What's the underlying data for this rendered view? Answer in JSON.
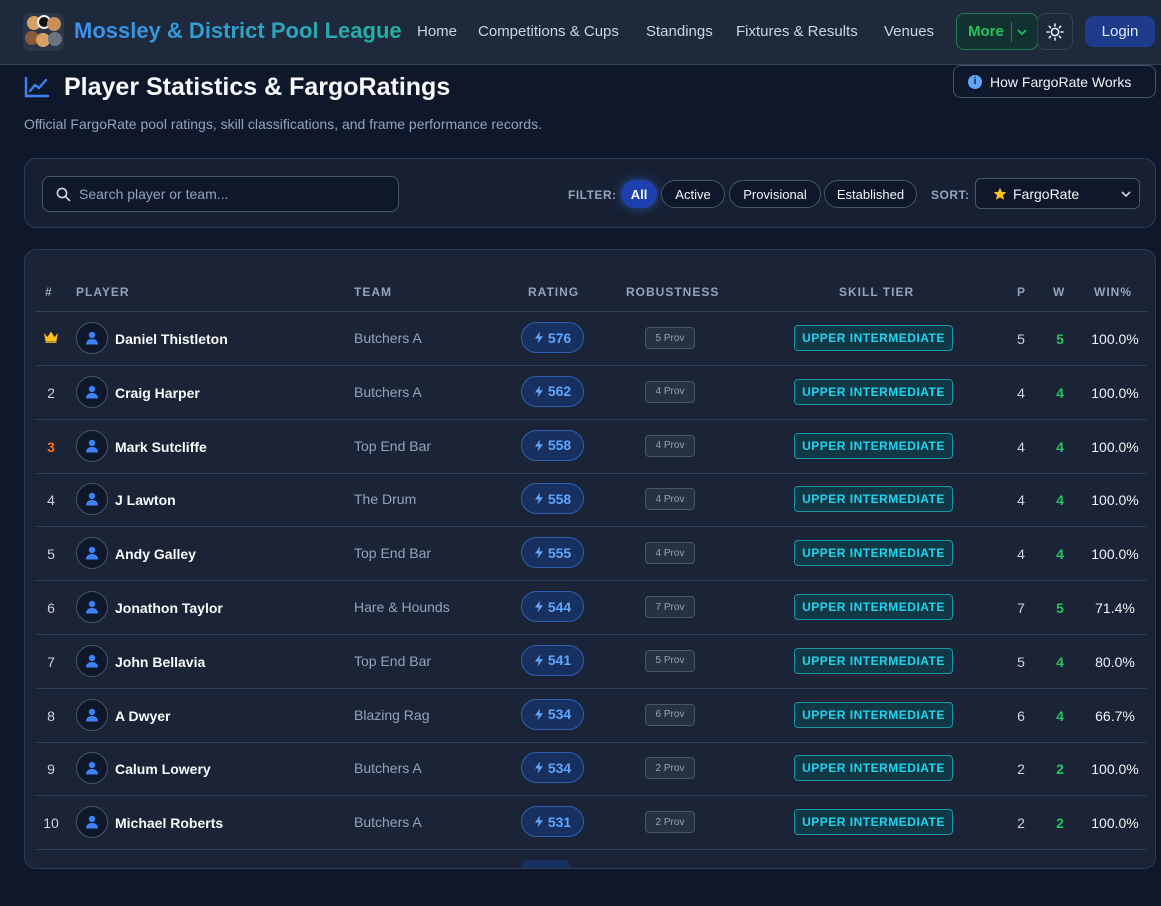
{
  "nav": {
    "brand": "Mossley & District Pool League",
    "links": [
      "Home",
      "Competitions & Cups",
      "Standings",
      "Fixtures & Results",
      "Venues"
    ],
    "more_label": "More",
    "login_label": "Login"
  },
  "header": {
    "title": "Player Statistics & FargoRatings",
    "subtitle": "Official FargoRate pool ratings, skill classifications, and frame performance records.",
    "how_button": "How FargoRate Works"
  },
  "filters": {
    "search_placeholder": "Search player or team...",
    "filter_label": "FILTER:",
    "options": [
      "All",
      "Active",
      "Provisional",
      "Established"
    ],
    "active_option": "All",
    "sort_label": "SORT:",
    "sort_value": "FargoRate"
  },
  "table": {
    "columns": [
      "#",
      "PLAYER",
      "TEAM",
      "RATING",
      "ROBUSTNESS",
      "SKILL TIER",
      "P",
      "W",
      "WIN%"
    ],
    "rows": [
      {
        "rank": "",
        "name": "Daniel Thistleton",
        "team": "Butchers A",
        "rating": "576",
        "robustness": "5 Prov",
        "tier": "UPPER INTERMEDIATE",
        "p": "5",
        "w": "5",
        "pct": "100.0%"
      },
      {
        "rank": "2",
        "name": "Craig Harper",
        "team": "Butchers A",
        "rating": "562",
        "robustness": "4 Prov",
        "tier": "UPPER INTERMEDIATE",
        "p": "4",
        "w": "4",
        "pct": "100.0%"
      },
      {
        "rank": "3",
        "name": "Mark Sutcliffe",
        "team": "Top End Bar",
        "rating": "558",
        "robustness": "4 Prov",
        "tier": "UPPER INTERMEDIATE",
        "p": "4",
        "w": "4",
        "pct": "100.0%"
      },
      {
        "rank": "4",
        "name": "J Lawton",
        "team": "The Drum",
        "rating": "558",
        "robustness": "4 Prov",
        "tier": "UPPER INTERMEDIATE",
        "p": "4",
        "w": "4",
        "pct": "100.0%"
      },
      {
        "rank": "5",
        "name": "Andy Galley",
        "team": "Top End Bar",
        "rating": "555",
        "robustness": "4 Prov",
        "tier": "UPPER INTERMEDIATE",
        "p": "4",
        "w": "4",
        "pct": "100.0%"
      },
      {
        "rank": "6",
        "name": "Jonathon Taylor",
        "team": "Hare & Hounds",
        "rating": "544",
        "robustness": "7 Prov",
        "tier": "UPPER INTERMEDIATE",
        "p": "7",
        "w": "5",
        "pct": "71.4%"
      },
      {
        "rank": "7",
        "name": "John Bellavia",
        "team": "Top End Bar",
        "rating": "541",
        "robustness": "5 Prov",
        "tier": "UPPER INTERMEDIATE",
        "p": "5",
        "w": "4",
        "pct": "80.0%"
      },
      {
        "rank": "8",
        "name": "A Dwyer",
        "team": "Blazing Rag",
        "rating": "534",
        "robustness": "6 Prov",
        "tier": "UPPER INTERMEDIATE",
        "p": "6",
        "w": "4",
        "pct": "66.7%"
      },
      {
        "rank": "9",
        "name": "Calum Lowery",
        "team": "Butchers A",
        "rating": "534",
        "robustness": "2 Prov",
        "tier": "UPPER INTERMEDIATE",
        "p": "2",
        "w": "2",
        "pct": "100.0%"
      },
      {
        "rank": "10",
        "name": "Michael Roberts",
        "team": "Butchers A",
        "rating": "531",
        "robustness": "2 Prov",
        "tier": "UPPER INTERMEDIATE",
        "p": "2",
        "w": "2",
        "pct": "100.0%"
      }
    ]
  },
  "icons": {
    "logo": "pool-balls-logo-icon",
    "theme": "sun-icon",
    "title": "chart-line-icon",
    "info": "info-icon",
    "search": "search-icon",
    "sort": "star-icon",
    "rating": "lightning-icon",
    "avatar": "user-icon",
    "top_rank": "crown-icon"
  },
  "colors": {
    "accent_blue": "#3b82f6",
    "accent_green": "#22c55e",
    "tier_cyan": "#22d3ee",
    "bronze": "#f97316",
    "crown": "#fbbf24"
  }
}
